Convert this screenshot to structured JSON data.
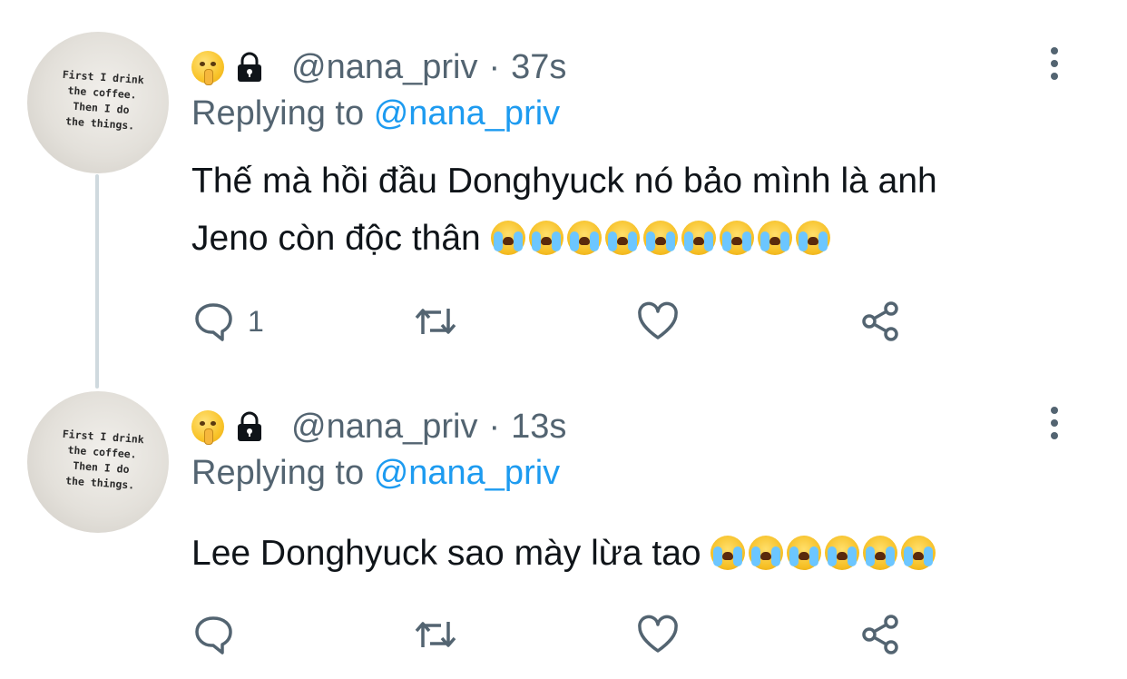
{
  "icons": {
    "avatar_emoji": "shushing-face-emoji",
    "protected": "lock-icon",
    "more": "more-vertical-icon",
    "reply": "reply-icon",
    "retweet": "retweet-icon",
    "like": "heart-icon",
    "share": "share-icon",
    "crying": "loudly-crying-face-emoji"
  },
  "colors": {
    "link": "#1d9bf0",
    "secondary_text": "#536471",
    "thread_line": "#cfd9de"
  },
  "tweets": [
    {
      "avatar_text": "First I drink\nthe coffee.\nThen I do\nthe things.",
      "handle": "@nana_priv",
      "separator": "·",
      "time": "37s",
      "replying_label": "Replying to",
      "replying_handle": "@nana_priv",
      "text_line1": "Thế mà hồi đầu Donghyuck nó bảo mình là anh",
      "text_line2": "Jeno còn độc thân",
      "crying_emoji_count": 9,
      "reply_count": "1"
    },
    {
      "avatar_text": "First I drink\nthe coffee.\nThen I do\nthe things.",
      "handle": "@nana_priv",
      "separator": "·",
      "time": "13s",
      "replying_label": "Replying to",
      "replying_handle": "@nana_priv",
      "text_line1": "Lee Donghyuck sao mày lừa tao",
      "crying_emoji_count": 6,
      "reply_count": ""
    }
  ]
}
